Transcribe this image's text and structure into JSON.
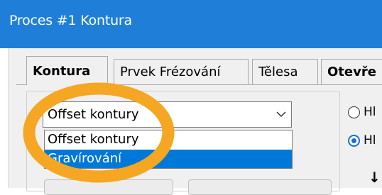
{
  "window": {
    "title": "Proces #1 Kontura"
  },
  "tabs": [
    {
      "label": "Kontura",
      "active": true
    },
    {
      "label": "Prvek Frézování",
      "active": false
    },
    {
      "label": "Tělesa",
      "active": false
    },
    {
      "label": "Otevře",
      "active": false
    }
  ],
  "combo": {
    "value": "Offset kontury",
    "options": [
      {
        "label": "Offset kontury",
        "selected": false
      },
      {
        "label": "Gravírování",
        "selected": true
      }
    ]
  },
  "radios": [
    {
      "label": "Hl",
      "checked": false
    },
    {
      "label": "Hl",
      "checked": true
    }
  ],
  "misc": {
    "arrow_glyph": "↓"
  },
  "colors": {
    "titlebar": "#1f7fd8",
    "selection": "#0078d7",
    "highlight_ring": "#f5a623"
  }
}
